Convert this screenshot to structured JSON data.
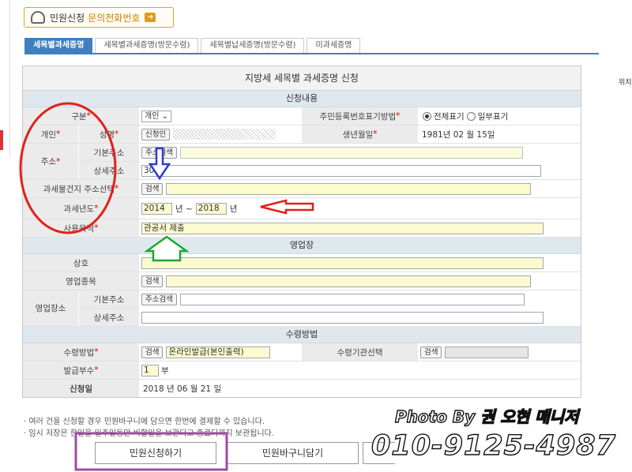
{
  "banner": {
    "text": "민원신청",
    "link": "문의전화번호"
  },
  "tabs": [
    "세목별과세증명",
    "세목별과세증명(방문수령)",
    "세목별납세증명(방문수령)",
    "미과세증명"
  ],
  "form": {
    "title": "지방세 세목별 과세증명 신청",
    "sections": {
      "apply": "신청내용",
      "business": "영업장",
      "receive": "수령방법"
    },
    "labels": {
      "gubun": "구분",
      "personal": "개인",
      "name": "성명",
      "address": "주소",
      "basic_addr": "기본주소",
      "detail_addr": "상세주소",
      "property_addr": "과세물건지 주소선택",
      "tax_year": "과세년도",
      "purpose": "사용목적",
      "id_method": "주민등록번호표기방법",
      "birth": "생년월일",
      "trade_name": "상호",
      "business_type": "영업종목",
      "biz_place": "영업장소",
      "receive_method": "수령방법",
      "receive_org": "수령기관선택",
      "copies": "발급부수",
      "apply_date": "신청일"
    },
    "values": {
      "gubun": "개인",
      "id_full": "전체표기",
      "id_partial": "일부표기",
      "birth": "1981년 02 월 15일",
      "detail_addr_prefix": "30-3",
      "year_from": "2014",
      "year_sep": "년 ~",
      "year_to": "2018",
      "year_end": "년",
      "purpose": "관공서 제출",
      "receive_method": "온라인발급(본인출력)",
      "copies": "1",
      "copies_unit": "부",
      "apply_date": "2018 년 06 월 21 일"
    },
    "buttons": {
      "verify": "신청인",
      "addr_search": "주소검색",
      "search": "검색"
    }
  },
  "notes": [
    "여러 건을 신청할 경우 민원바구니에 담으면 한번에 결제할 수 있습니다.",
    "임시 저장은 한일을 일주일동안 비할일을 보관되고 종료되까지 보관됩니다."
  ],
  "bottom_buttons": [
    "민원신청하기",
    "민원바구니담기"
  ],
  "watermark": {
    "line1": "Photo By 권 오현 매니저",
    "line2": "010-9125-4987"
  },
  "side_text": "위치",
  "colors": {
    "annotation_red": "#e0211b",
    "annotation_blue": "#2d3ad6",
    "annotation_green": "#1fa62e",
    "annotation_purple": "#a04aa6",
    "tab_active": "#3f7fbf"
  }
}
